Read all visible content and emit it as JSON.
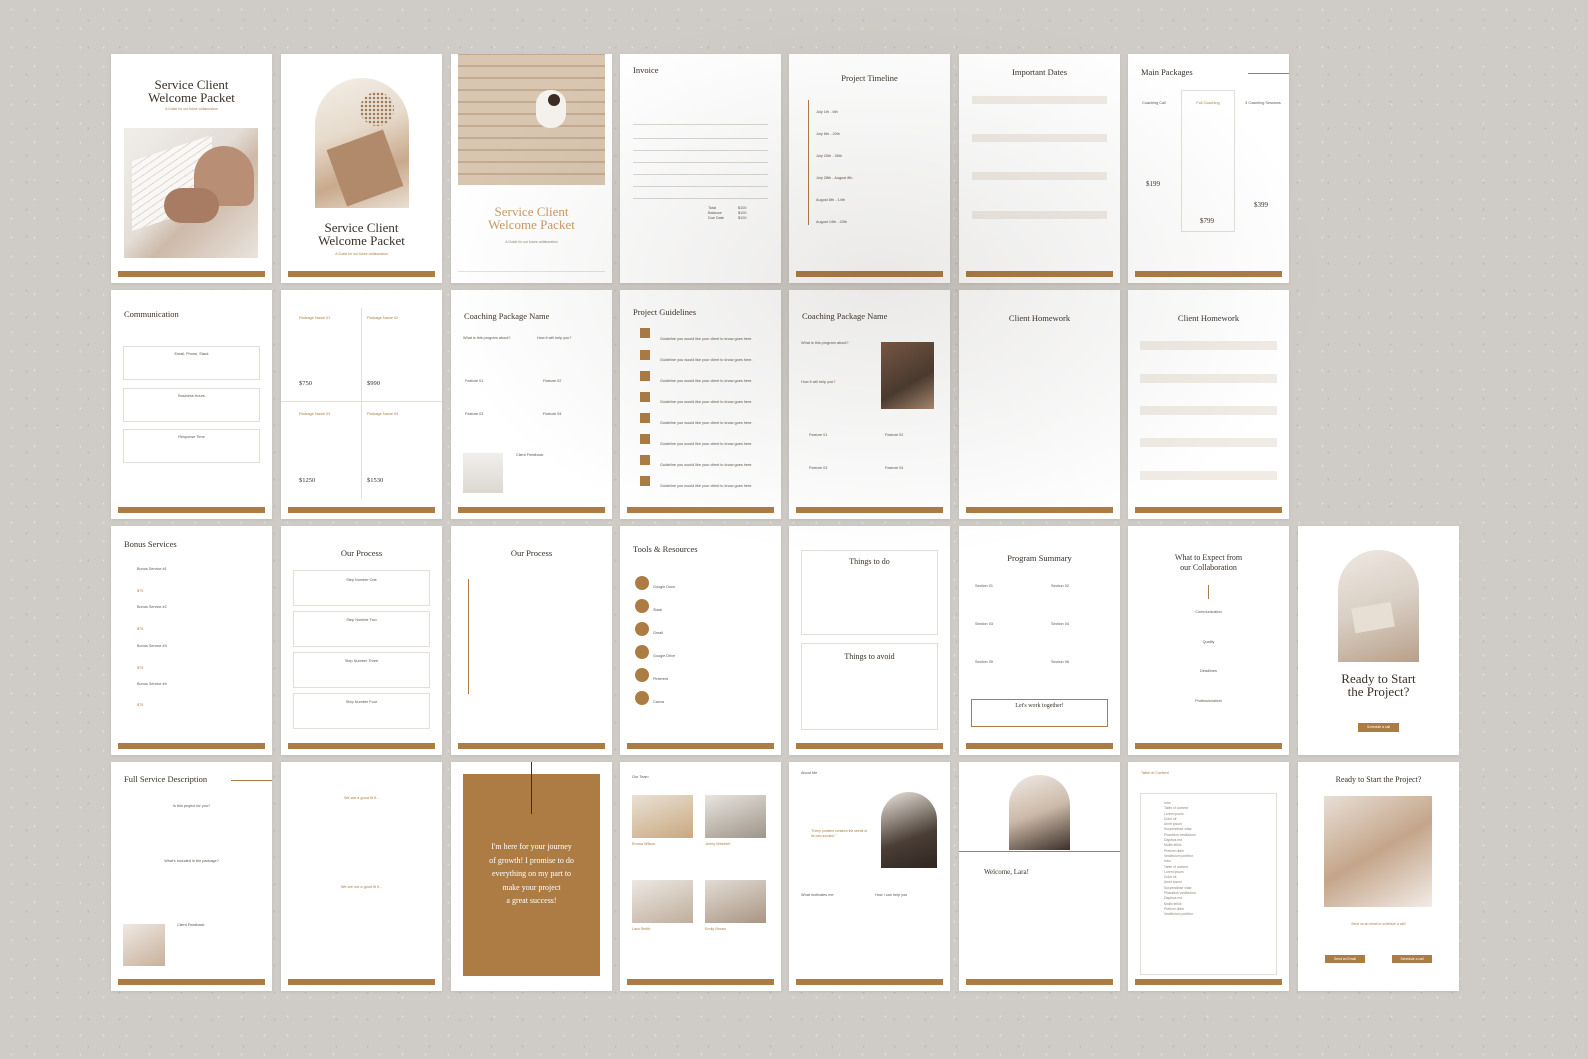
{
  "colors": {
    "accent": "#ac7c44",
    "background": "#cfcbc6",
    "page": "#ffffff",
    "text": "#3a3028"
  },
  "p1": {
    "title_line1": "Service Client",
    "title_line2": "Welcome Packet",
    "subtitle": "A Guide for our future collaboration"
  },
  "p2": {
    "title_line1": "Service Client",
    "title_line2": "Welcome Packet",
    "subtitle": "A Guide for our future collaboration"
  },
  "p3": {
    "title_line1": "Service Client",
    "title_line2": "Welcome Packet",
    "subtitle": "A Guide for our future collaboration"
  },
  "p4": {
    "title": "Invoice",
    "totals": [
      "Total",
      "Balance",
      "Due Date"
    ],
    "amounts": [
      "$100",
      "$100",
      "$100"
    ]
  },
  "p5": {
    "title": "Project Timeline",
    "dates": [
      "July 1th - 6th",
      "July 6th - 20th",
      "July 20th - 28th",
      "July 28th - August 8th",
      "August 8th - 14th",
      "August 14th - 20th"
    ]
  },
  "p6": {
    "title": "Important Dates"
  },
  "p7": {
    "title": "Main Packages",
    "packages": [
      "Coaching Call",
      "Full Coaching",
      "3 Coaching Sessions"
    ],
    "prices": [
      "$199",
      "$799",
      "$399"
    ]
  },
  "p8": {
    "title": "Communication",
    "items": [
      "Email, Phone, Slack",
      "Business Hours",
      "Response Time"
    ]
  },
  "p9": {
    "names": [
      "Package Name 01",
      "Package Name 02",
      "Package Name 03",
      "Package Name 04"
    ],
    "prices": [
      "$750",
      "$990",
      "$1250",
      "$1530"
    ]
  },
  "p10": {
    "title": "Coaching Package Name",
    "q1": "What is this program about?",
    "q2": "How it will help you?",
    "features": [
      "Feature 01",
      "Feature 02",
      "Feature 03",
      "Feature 04"
    ],
    "feedback": "Client Feedback"
  },
  "p11": {
    "title": "Project Guidelines",
    "item": "Guideline you would like your client to know goes here."
  },
  "p12": {
    "title": "Coaching Package Name",
    "q1": "What is this program about?",
    "q2": "How it will help you?",
    "features": [
      "Feature 01",
      "Feature 02",
      "Feature 03",
      "Feature 04"
    ]
  },
  "p13": {
    "title": "Client Homework"
  },
  "p14": {
    "title": "Client Homework"
  },
  "p15": {
    "title": "Bonus Services",
    "items": [
      "Bonus Service #1",
      "Bonus Service #2",
      "Bonus Service #3",
      "Bonus Service #4"
    ],
    "price": "$79"
  },
  "p16": {
    "title": "Our Process",
    "steps": [
      "Step Number One",
      "Step Number Two",
      "Step Number Three",
      "Step Number Four"
    ]
  },
  "p17": {
    "title": "Our Process"
  },
  "p18": {
    "title": "Tools & Resources",
    "tools": [
      "Google Docs",
      "Slack",
      "Gmail",
      "Google Drive",
      "Pinterest",
      "Canva"
    ]
  },
  "p19": {
    "todo": "Things to do",
    "avoid": "Things to avoid"
  },
  "p20": {
    "title": "Program Summary",
    "sections": [
      "Section 01",
      "Section 02",
      "Section 03",
      "Section 04",
      "Section 05",
      "Section 06"
    ],
    "cta": "Let's work together!"
  },
  "p21": {
    "title_line1": "What to Expect from",
    "title_line2": "our Collaboration",
    "items": [
      "Communication",
      "Quality",
      "Deadlines",
      "Professionalism"
    ]
  },
  "p22": {
    "title_line1": "Ready to Start",
    "title_line2": "the Project?",
    "button": "Schedule a call"
  },
  "p23": {
    "title": "Full Service Description",
    "q1": "Is this project for you?",
    "q2": "What's included in the package?",
    "feedback": "Client Feedback"
  },
  "p24": {
    "good": "We are a good fit if...",
    "bad": "We are not a good fit if..."
  },
  "p25": {
    "quote_lines": [
      "I'm here for your journey",
      "of growth! I promise to do",
      "everything on my part to",
      "make your project",
      "a great success!"
    ]
  },
  "p26": {
    "title": "Our Team",
    "members": [
      "Emma Wilson",
      "Jenny Wheeler",
      "Lara Smith",
      "Emily Brown"
    ]
  },
  "p27": {
    "title": "About Me",
    "quote": "\"Every problem contains the seeds of its own solution.\"",
    "h1": "What motivates me",
    "h2": "How I can help you"
  },
  "p28": {
    "greeting": "Welcome, Lara!"
  },
  "p29": {
    "title": "Table of Content",
    "entries": [
      "Intro",
      "Table of content",
      "Lorem ipsum",
      "Dolor sit",
      "Amet ipsum",
      "Suspendisse vitae",
      "Phasellus vestibulum",
      "Dapibus est",
      "Mollis tellus",
      "Pretium diam",
      "Vestibulum porttitor",
      "Intro",
      "Table of content",
      "Lorem ipsum",
      "Dolor sit",
      "Amet ipsum",
      "Suspendisse vitae",
      "Phasellus vestibulum",
      "Dapibus est",
      "Mollis tellus",
      "Pretium diam",
      "Vestibulum porttitor"
    ]
  },
  "p30": {
    "title": "Ready to Start the Project?",
    "cta": "Send us an email or schedule a call!",
    "btn1": "Send an Email",
    "btn2": "Schedule a call"
  }
}
